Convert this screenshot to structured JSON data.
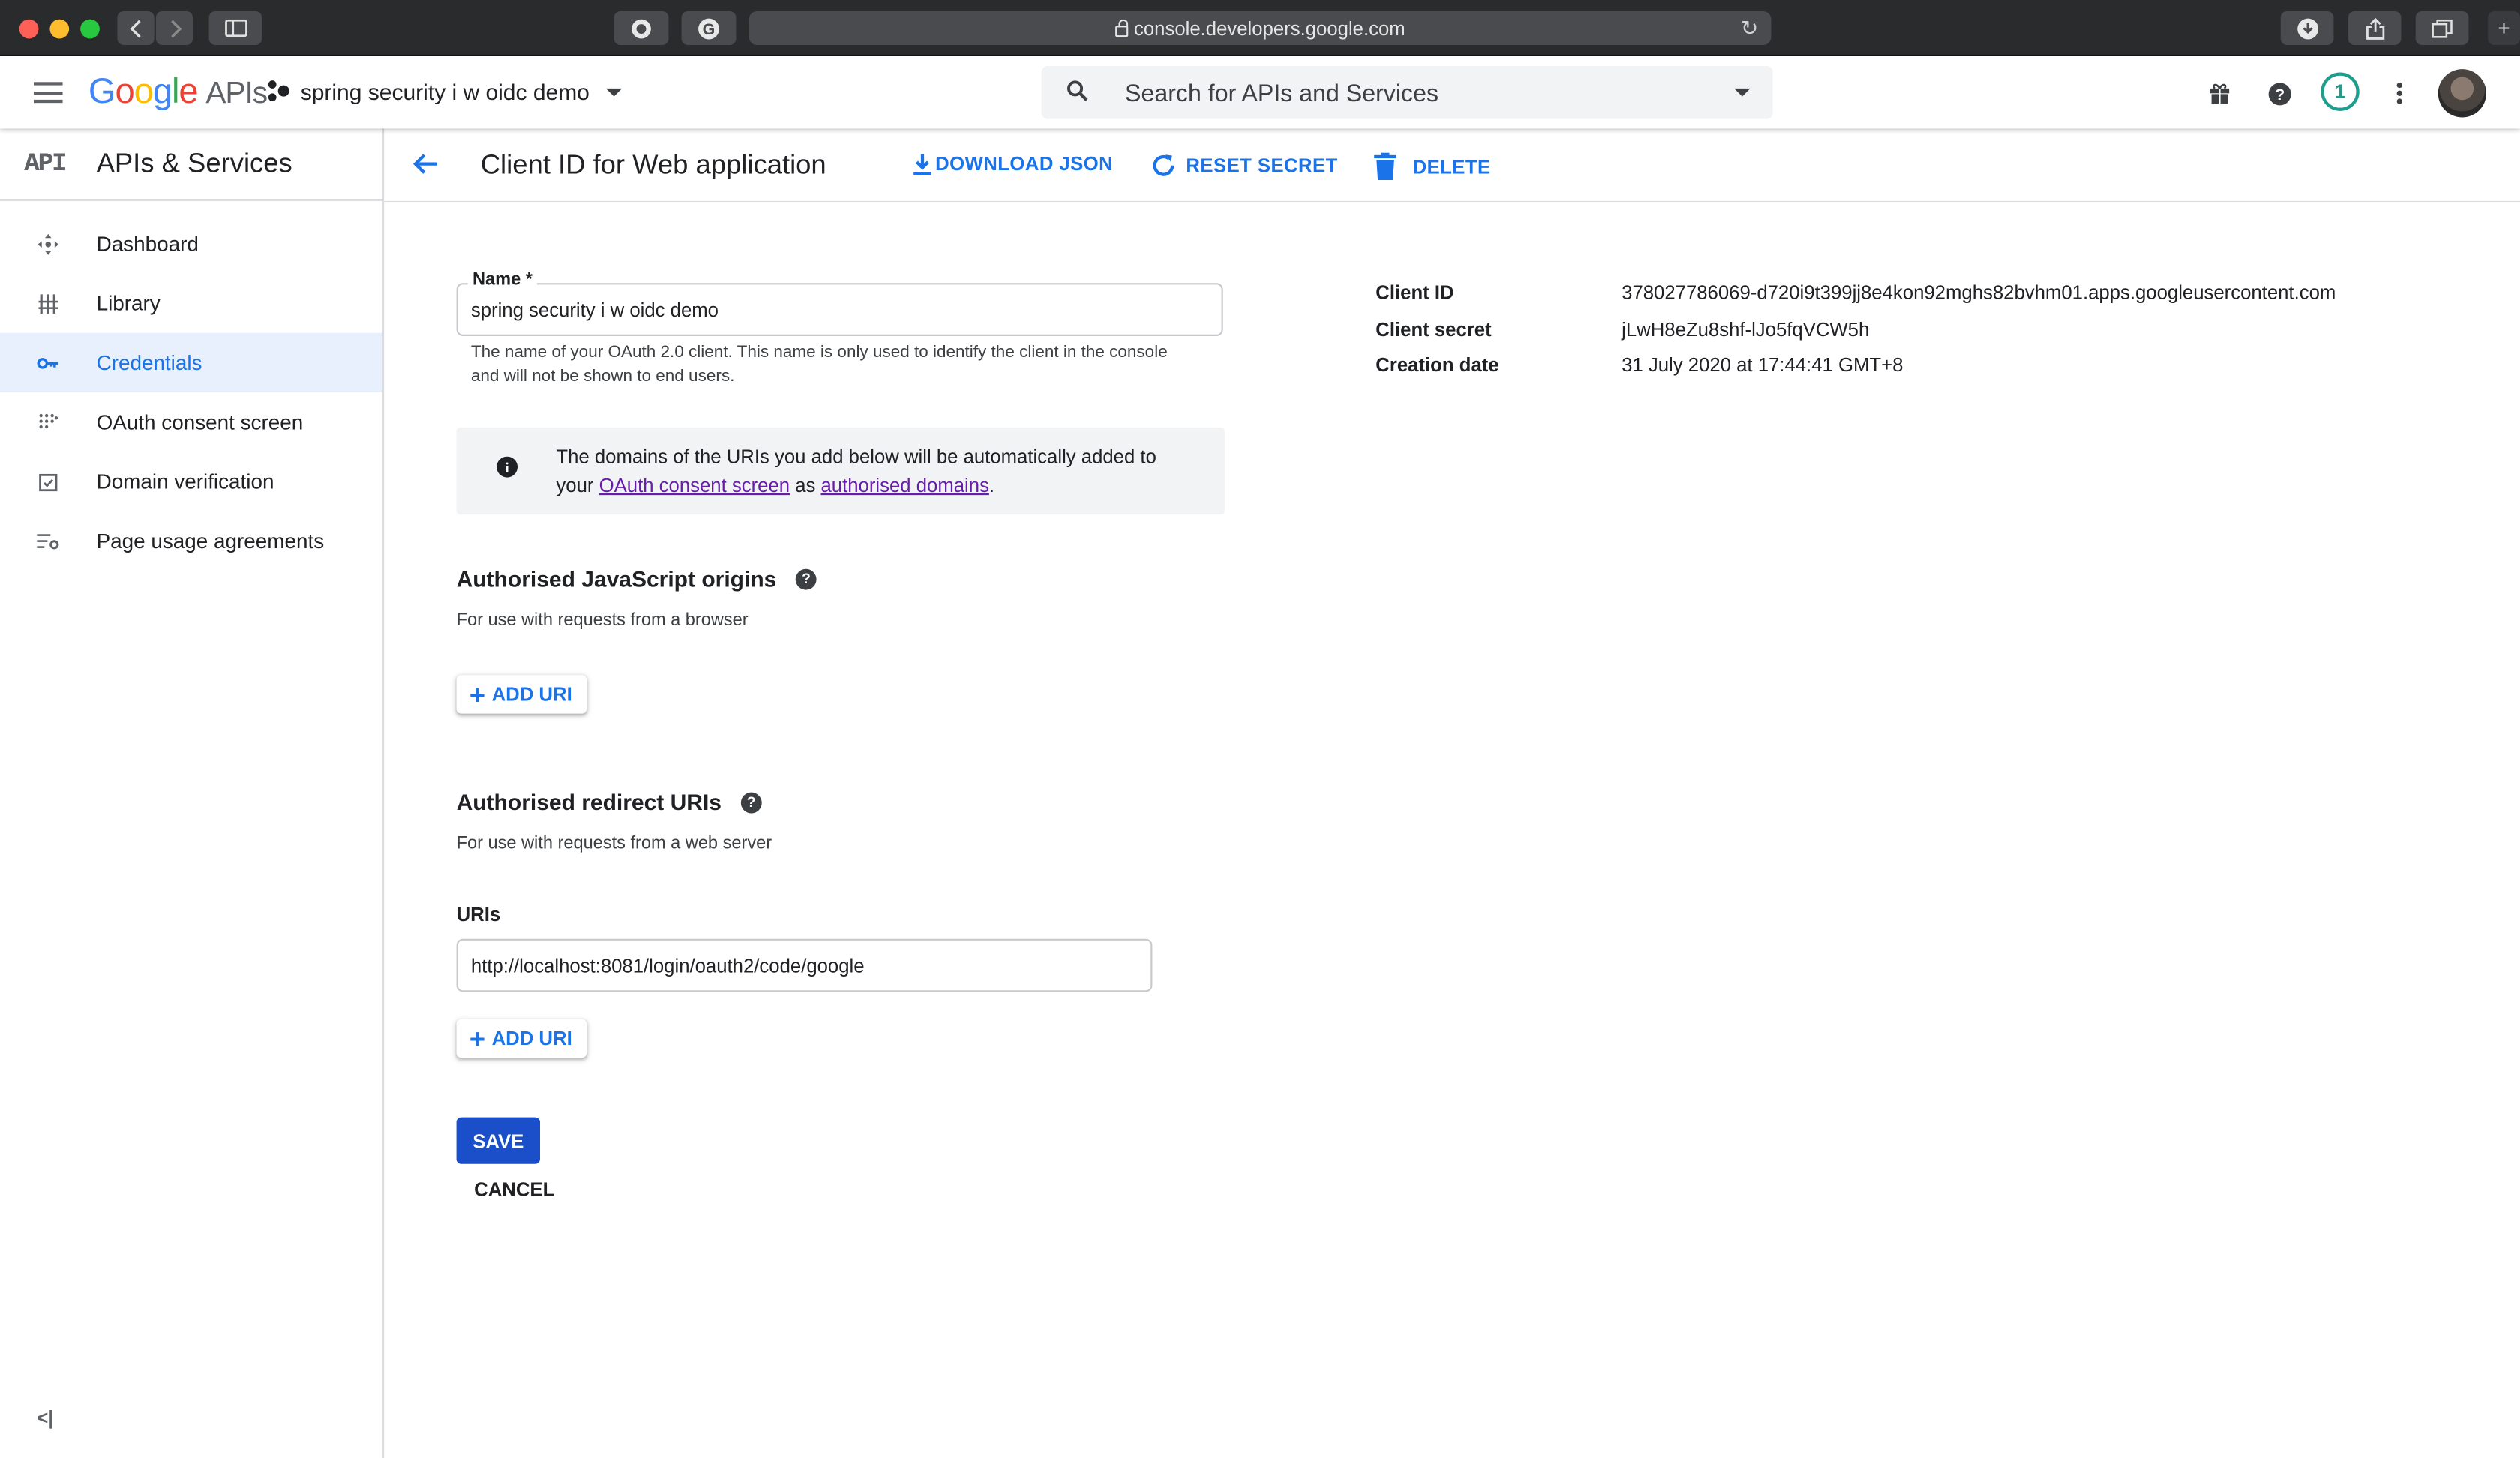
{
  "browser": {
    "url": "console.developers.google.com"
  },
  "appbar": {
    "logo_google": "Google",
    "logo_apis": "APIs",
    "project": "spring security i w oidc demo",
    "search_placeholder": "Search for APIs and Services",
    "notification_count": "1"
  },
  "sidebar": {
    "title": "APIs & Services",
    "api_icon": "API",
    "items": [
      {
        "label": "Dashboard",
        "icon": "dashboard-icon"
      },
      {
        "label": "Library",
        "icon": "library-icon"
      },
      {
        "label": "Credentials",
        "icon": "key-icon",
        "active": true
      },
      {
        "label": "OAuth consent screen",
        "icon": "consent-icon"
      },
      {
        "label": "Domain verification",
        "icon": "checkbox-icon"
      },
      {
        "label": "Page usage agreements",
        "icon": "settings-list-icon"
      }
    ],
    "collapse_glyph": "<|"
  },
  "header": {
    "title": "Client ID for Web application",
    "download": "DOWNLOAD JSON",
    "reset": "RESET SECRET",
    "delete": "DELETE"
  },
  "form": {
    "name_label": "Name *",
    "name_value": "spring security i w oidc demo",
    "name_hint": "The name of your OAuth 2.0 client. This name is only used to identify the client in the console and will not be shown to end users.",
    "info_text_1": "The domains of the URIs you add below will be automatically added to your ",
    "info_link_1": "OAuth consent screen",
    "info_text_2": " as ",
    "info_link_2": "authorised domains",
    "info_text_3": ".",
    "js_origins_title": "Authorised JavaScript origins",
    "js_origins_sub": "For use with requests from a browser",
    "add_uri": "ADD URI",
    "redirect_title": "Authorised redirect URIs",
    "redirect_sub": "For use with requests from a web server",
    "uris_label": "URIs",
    "uri_value": "http://localhost:8081/login/oauth2/code/google",
    "save": "SAVE",
    "cancel": "CANCEL"
  },
  "details": {
    "client_id_label": "Client ID",
    "client_id": "378027786069-d720i9t399jj8e4kon92mghs82bvhm01.apps.googleusercontent.com",
    "client_secret_label": "Client secret",
    "client_secret": "jLwH8eZu8shf-lJo5fqVCW5h",
    "creation_label": "Creation date",
    "creation": "31 July 2020 at 17:44:41 GMT+8"
  },
  "colors": {
    "accent": "#1a73e8",
    "save_button": "#1a4fc9",
    "link_visited": "#681da8",
    "badge": "#1e9e8e"
  }
}
